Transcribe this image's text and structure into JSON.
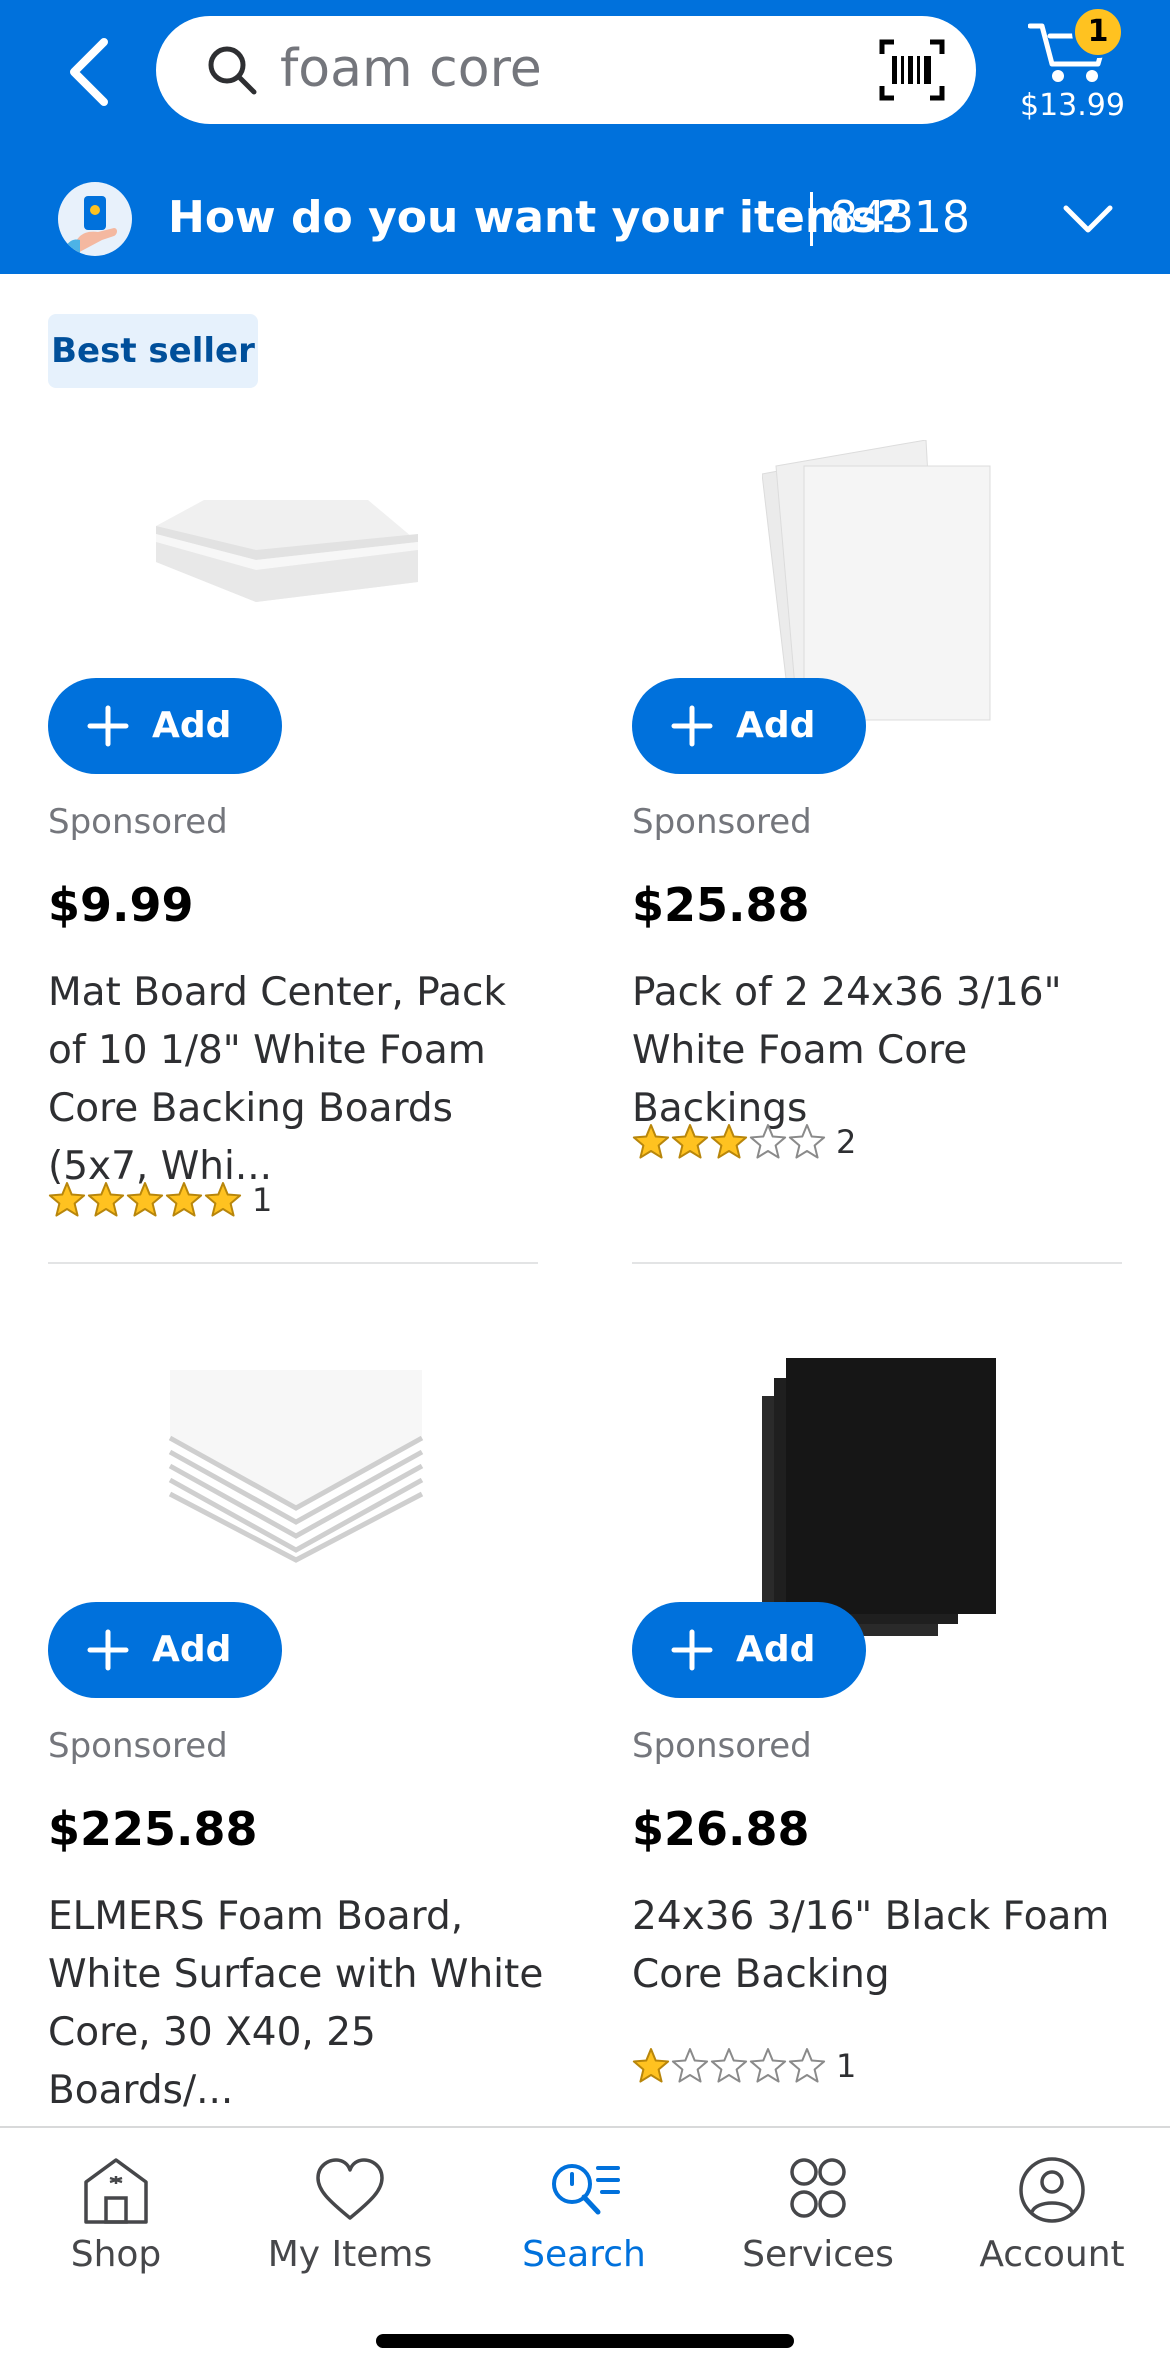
{
  "header": {
    "search_query": "foam core",
    "cart_count": "1",
    "cart_total": "$13.99"
  },
  "fulfillment": {
    "question": "How do you want your items?",
    "zip": "84318"
  },
  "best_seller_label": "Best seller",
  "products": [
    {
      "add_label": "Add",
      "sponsored": "Sponsored",
      "price": "$9.99",
      "title": "Mat Board Center, Pack of 10 1/8\" White Foam Core Backing Boards (5x7, Whi...",
      "rating": 5,
      "review_count": "1"
    },
    {
      "add_label": "Add",
      "sponsored": "Sponsored",
      "price": "$25.88",
      "title": "Pack of 2 24x36 3/16\" White Foam Core Backings",
      "rating": 3,
      "review_count": "2"
    },
    {
      "add_label": "Add",
      "sponsored": "Sponsored",
      "price": "$225.88",
      "title": "ELMERS Foam Board, White Surface with White Core, 30 X40, 25 Boards/...",
      "rating": null,
      "review_count": ""
    },
    {
      "add_label": "Add",
      "sponsored": "Sponsored",
      "price": "$26.88",
      "title": "24x36 3/16\" Black Foam Core Backing",
      "rating": 1,
      "review_count": "1"
    }
  ],
  "bottom_nav": {
    "shop": "Shop",
    "my_items": "My Items",
    "search": "Search",
    "services": "Services",
    "account": "Account"
  },
  "colors": {
    "brand_blue": "#0071dc",
    "star_yellow": "#ffc220",
    "badge_bg": "#e6f1fc"
  }
}
